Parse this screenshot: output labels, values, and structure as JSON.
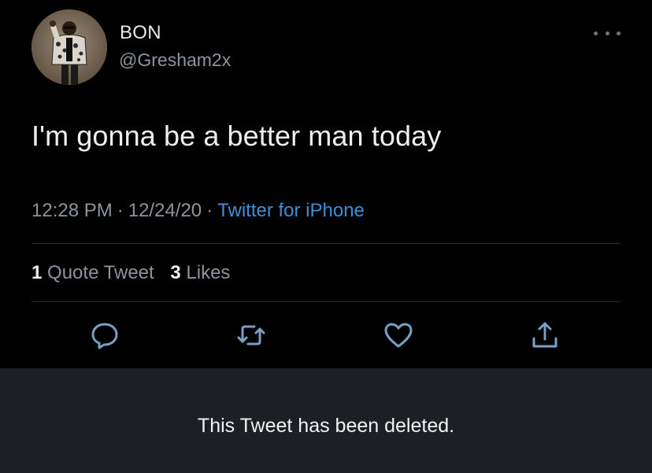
{
  "tweet": {
    "author": {
      "display_name": "BON",
      "handle": "@Gresham2x",
      "avatar_icon": "user-avatar-photo"
    },
    "text": "I'm gonna be a better man today",
    "meta": {
      "time": "12:28 PM",
      "date": "12/24/20",
      "separator": "·",
      "source": "Twitter for iPhone"
    },
    "stats": {
      "quote_tweets_count": "1",
      "quote_tweets_label": "Quote Tweet",
      "likes_count": "3",
      "likes_label": "Likes"
    },
    "actions": [
      {
        "name": "reply",
        "icon": "reply-icon"
      },
      {
        "name": "retweet",
        "icon": "retweet-icon"
      },
      {
        "name": "like",
        "icon": "heart-icon"
      },
      {
        "name": "share",
        "icon": "share-icon"
      }
    ],
    "more_icon": "more-options-icon"
  },
  "banner": {
    "text": "This Tweet has been deleted."
  },
  "colors": {
    "background": "#000000",
    "banner_background": "#1c1f23",
    "secondary_text": "#8b949c",
    "link": "#3e8fd8",
    "icon": "#7b9ec7"
  }
}
